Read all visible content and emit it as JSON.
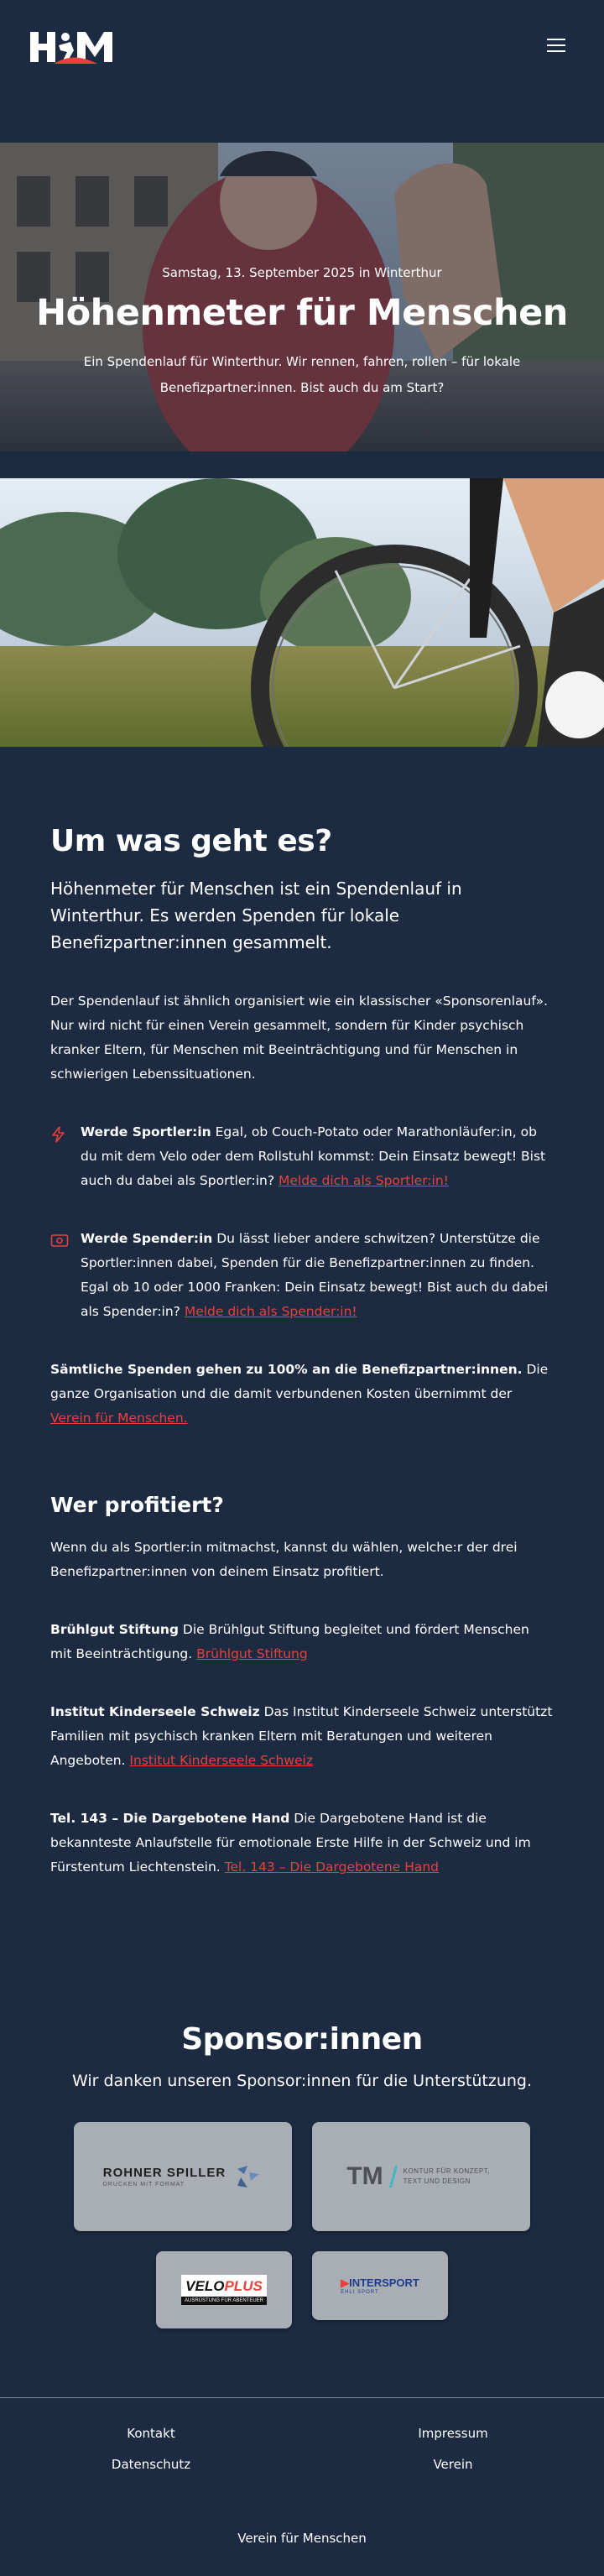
{
  "header": {
    "logo_alt": "HfM",
    "menu_icon": "hamburger-icon"
  },
  "hero": {
    "date": "Samstag, 13. September 2025 in Winterthur",
    "title": "Höhenmeter für Menschen",
    "subtitle": "Ein Spendenlauf für Winterthur. Wir rennen, fahren, rollen – für lokale Benefizpartner:innen. Bist auch du am Start?"
  },
  "about": {
    "heading": "Um was geht es?",
    "lead": "Höhenmeter für Menschen ist ein Spendenlauf in Winterthur. Es werden Spenden für lokale Benefizpartner:innen gesammelt.",
    "intro": "Der Spendenlauf ist ähnlich organisiert wie ein klassischer «Sponsorenlauf». Nur wird nicht für einen Verein gesammelt, sondern für Kinder psychisch kranker Eltern, für Menschen mit Beeinträchtigung und für Menschen in schwierigen Lebenssituationen.",
    "athlete_bold": "Werde Sportler:in",
    "athlete_text": " Egal, ob Couch-Potato oder Marathonläufer:in, ob du mit dem Velo oder dem Rollstuhl kommst: Dein Einsatz bewegt! Bist auch du dabei als Sportler:in? ",
    "athlete_link": "Melde dich als Sportler:in!",
    "donor_bold": "Werde Spender:in",
    "donor_text": " Du lässt lieber andere schwitzen? Unterstütze die Sportler:innen dabei, Spenden für die Benefizpartner:innen zu finden. Egal ob 10 oder 1000 Franken: Dein Einsatz bewegt! Bist auch du dabei als Spender:in? ",
    "donor_link": "Melde dich als Spender:in!",
    "all_bold": "Sämtliche Spenden gehen zu 100% an die Benefizpartner:innen.",
    "all_text": " Die ganze Organisation und die damit verbundenen Kosten übernimmt der ",
    "all_link": "Verein für Menschen."
  },
  "beneficiaries": {
    "heading": "Wer profitiert?",
    "intro": "Wenn du als Sportler:in mitmachst, kannst du wählen, welche:r der drei Benefizpartner:innen von deinem Einsatz profitiert.",
    "items": [
      {
        "name": "Brühlgut Stiftung",
        "text": " Die Brühlgut Stiftung begleitet und fördert Menschen mit Beeinträchtigung. ",
        "link": "Brühlgut Stiftung"
      },
      {
        "name": "Institut Kinderseele Schweiz",
        "text": " Das Institut Kinderseele Schweiz unterstützt Familien mit psychisch kranken Eltern mit Beratungen und weiteren Angeboten. ",
        "link": "Institut Kinderseele Schweiz"
      },
      {
        "name": "Tel. 143 – Die Dargebotene Hand",
        "text": " Die Dargebotene Hand ist die bekannteste Anlaufstelle für emotionale Erste Hilfe in der Schweiz und im Fürstentum Liechtenstein. ",
        "link": "Tel. 143 – Die Dargebotene Hand"
      }
    ]
  },
  "sponsors": {
    "heading": "Sponsor:innen",
    "subheading": "Wir danken unseren Sponsor:innen für die Unterstützung.",
    "logos": [
      {
        "name": "ROHNER SPILLER",
        "tagline": "DRUCKEN MIT FORMAT"
      },
      {
        "name": "TM",
        "tagline": "KONTUR FÜR KONZEPT, TEXT UND DESIGN"
      },
      {
        "name": "VELOPLUS",
        "tagline": "AUSRÜSTUNG FÜR ABENTEUER"
      },
      {
        "name": "INTERSPORT",
        "tagline": "EHLI SPORT"
      }
    ]
  },
  "footer": {
    "col1": [
      "Kontakt",
      "Datenschutz"
    ],
    "col2": [
      "Impressum",
      "Verein"
    ],
    "bottom": "Verein für Menschen"
  },
  "colors": {
    "background": "#1c2a42",
    "accent": "#e8413c",
    "card": "#a9adb4"
  }
}
